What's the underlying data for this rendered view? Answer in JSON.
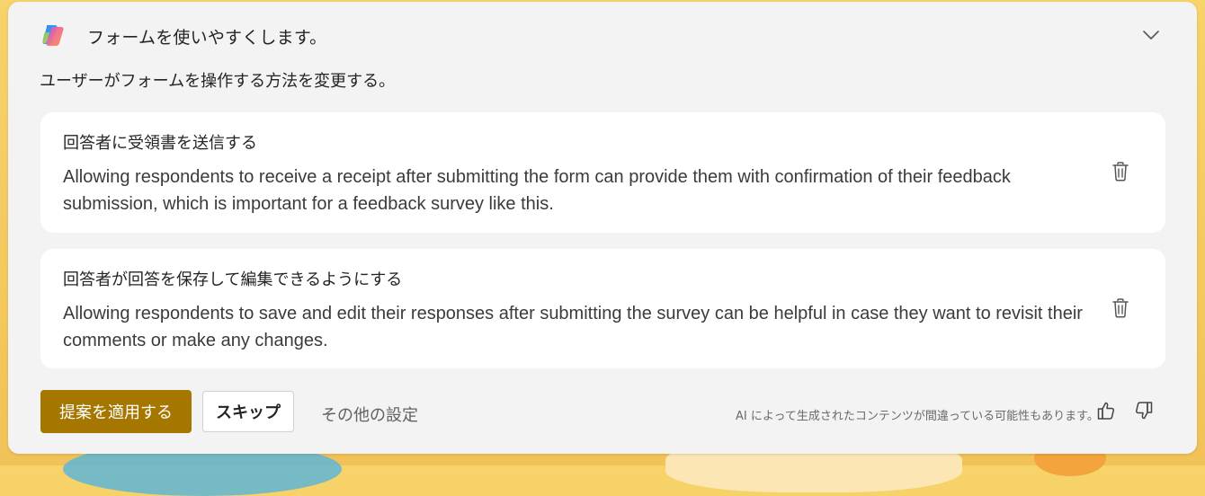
{
  "header": {
    "title": "フォームを使いやすくします。",
    "icon": "copilot-icon",
    "collapse_icon": "chevron-down-icon"
  },
  "subtitle": "ユーザーがフォームを操作する方法を変更する。",
  "suggestions": [
    {
      "title": "回答者に受領書を送信する",
      "description": "Allowing respondents to receive a receipt after submitting the form can provide them with confirmation of their feedback submission, which is important for a feedback survey like this.",
      "delete_icon": "trash-icon"
    },
    {
      "title": "回答者が回答を保存して編集できるようにする",
      "description": "Allowing respondents to save and edit their responses after submitting the survey can be helpful in case they want to revisit their comments or make any changes.",
      "delete_icon": "trash-icon"
    }
  ],
  "footer": {
    "apply_label": "提案を適用する",
    "skip_label": "スキップ",
    "more_settings_label": "その他の設定",
    "disclaimer": "AI によって生成されたコンテンツが間違っている可能性もあります。",
    "like_icon": "thumbs-up-icon",
    "dislike_icon": "thumbs-down-icon"
  },
  "colors": {
    "accent": "#a67700",
    "background": "#f7d36a",
    "panel": "#f3f3f3",
    "card": "#ffffff"
  }
}
